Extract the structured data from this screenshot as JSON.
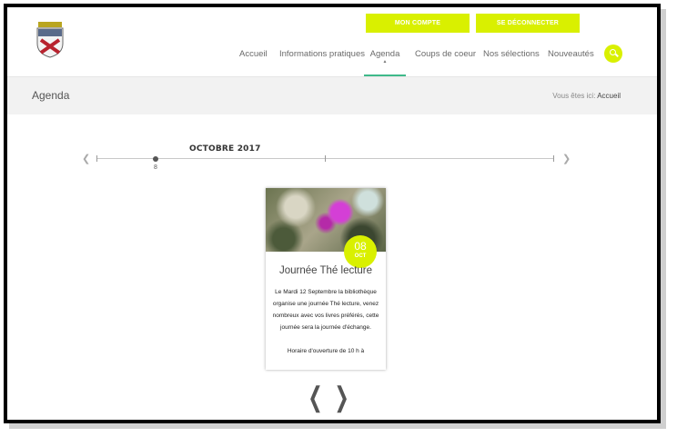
{
  "header": {
    "account_button": "MON COMPTE",
    "logout_button": "SE DÉCONNECTER"
  },
  "nav": {
    "items": [
      {
        "label": "Accueil"
      },
      {
        "label": "Informations pratiques"
      },
      {
        "label": "Agenda"
      },
      {
        "label": "Coups de coeur"
      },
      {
        "label": "Nos sélections"
      },
      {
        "label": "Nouveautés"
      }
    ],
    "active_index": 2,
    "search_icon": "search-icon"
  },
  "page": {
    "title": "Agenda",
    "breadcrumb_prefix": "Vous êtes ici:",
    "breadcrumb_link": "Accueil"
  },
  "timeline": {
    "month_label": "OCTOBRE 2017",
    "selected_day": "8",
    "prev_icon": "chevron-left-icon",
    "next_icon": "chevron-right-icon"
  },
  "event": {
    "day": "08",
    "month": "OCT",
    "title": "Journée Thé lecture",
    "description": "Le Mardi 12 Septembre la bibliothèque organise une journée Thé lecture, venez nombreux avec vos livres préférés, cette journée sera la journée d'échange.",
    "extra": "Horaire d'ouverture de 10 h à"
  },
  "pager": {
    "prev": "❮",
    "next": "❯"
  },
  "colors": {
    "accent": "#d9f000",
    "active_underline": "#3fb98a"
  }
}
